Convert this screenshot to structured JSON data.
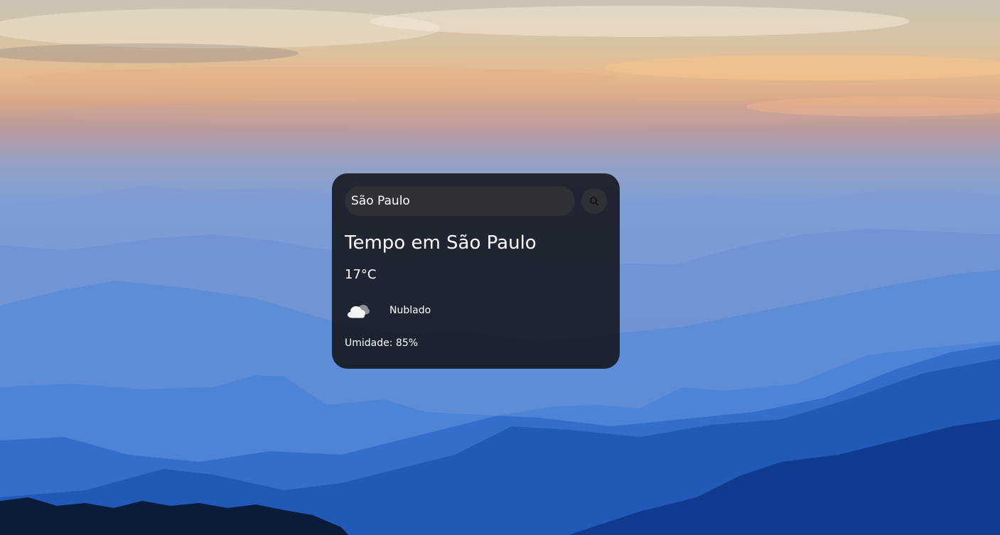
{
  "search": {
    "value": "São Paulo",
    "icon": "search-icon"
  },
  "weather": {
    "title": "Tempo em São Paulo",
    "temperature": "17°C",
    "icon": "cloud-icon",
    "description": "Nublado",
    "humidity": "Umidade: 85%"
  },
  "colors": {
    "card": "#101216",
    "input": "#2e3135",
    "text": "#ffffff"
  }
}
